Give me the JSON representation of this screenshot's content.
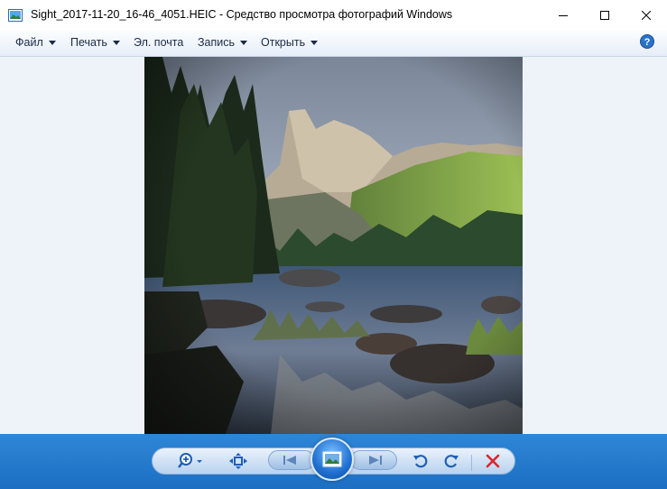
{
  "window": {
    "title": "Sight_2017-11-20_16-46_4051.HEIC - Средство просмотра фотографий Windows"
  },
  "menu": {
    "items": [
      {
        "label": "Файл",
        "has_dropdown": true
      },
      {
        "label": "Печать",
        "has_dropdown": true
      },
      {
        "label": "Эл. почта",
        "has_dropdown": false
      },
      {
        "label": "Запись",
        "has_dropdown": true
      },
      {
        "label": "Открыть",
        "has_dropdown": true
      }
    ]
  },
  "icons": {
    "app": "photo-viewer-icon",
    "help": "help-icon",
    "zoom": "zoom-icon",
    "fit": "actual-size-icon",
    "prev": "previous-icon",
    "slideshow": "slideshow-icon",
    "next": "next-icon",
    "rotate_ccw": "rotate-counterclockwise-icon",
    "rotate_cw": "rotate-clockwise-icon",
    "delete": "delete-icon"
  },
  "colors": {
    "accent": "#1c6fc3",
    "menu_text": "#1b2a44",
    "delete": "#d9282f",
    "viewport_bg": "#eef3fa"
  }
}
